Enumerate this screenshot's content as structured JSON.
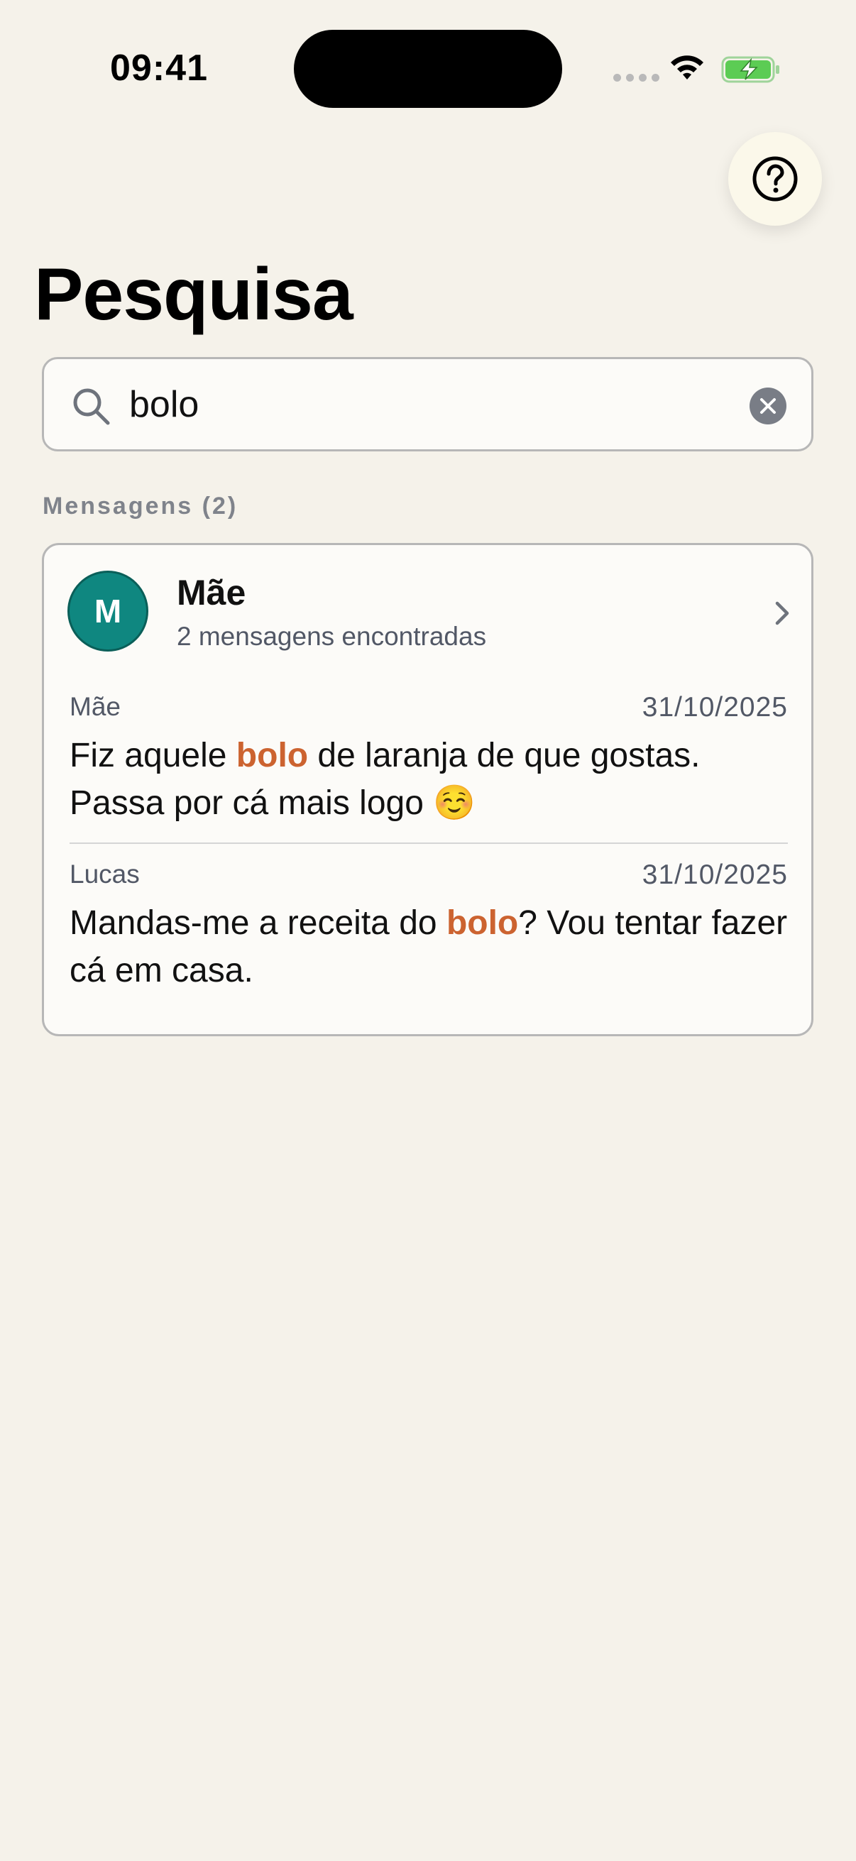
{
  "status_bar": {
    "time": "09:41",
    "icons": [
      "cellular-signal-icon",
      "wifi-icon",
      "battery-charging-icon"
    ]
  },
  "help_button": {
    "icon": "question-circle-icon"
  },
  "page": {
    "title": "Pesquisa"
  },
  "search": {
    "value": "bolo",
    "icon": "search-icon",
    "clear_icon": "clear-icon"
  },
  "results": {
    "section_header": "Mensagens (2)",
    "card": {
      "avatar_initial": "M",
      "avatar_color": "#0f8780",
      "contact_name": "Mãe",
      "match_count": "2 mensagens encontradas",
      "chevron_icon": "chevron-right-icon",
      "highlight_color": "#cc6330",
      "messages": [
        {
          "sender": "Mãe",
          "date": "31/10/2025",
          "text_before": "Fiz aquele ",
          "match": "bolo",
          "text_after": " de laranja de que gostas. Passa por cá mais logo ☺️"
        },
        {
          "sender": "Lucas",
          "date": "31/10/2025",
          "text_before": "Mandas-me a receita do ",
          "match": "bolo",
          "text_after": "? Vou tentar fazer cá em casa."
        }
      ]
    }
  }
}
